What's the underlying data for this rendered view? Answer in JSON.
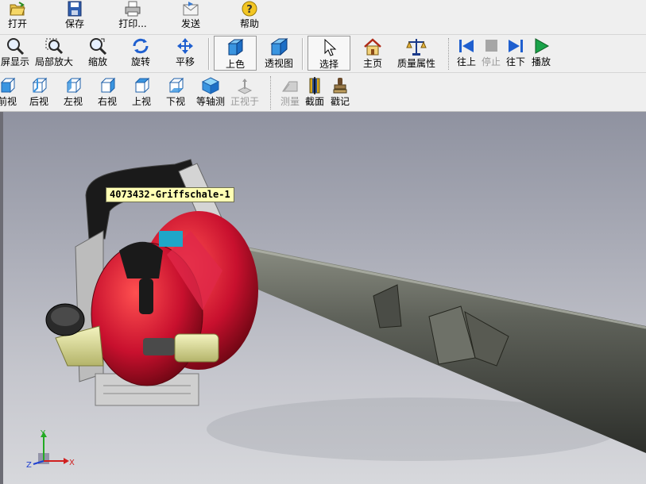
{
  "toolbar_main": {
    "open": "打开",
    "save": "保存",
    "print": "打印...",
    "send": "发送",
    "help": "帮助"
  },
  "toolbar_view": {
    "fit": "屏显示",
    "zoom_area": "局部放大",
    "zoom": "缩放",
    "rotate": "旋转",
    "pan": "平移",
    "shaded": "上色",
    "perspective": "透视图",
    "select": "选择",
    "home": "主页",
    "mass_properties": "质量属性",
    "previous": "往上",
    "stop": "停止",
    "next": "往下",
    "play": "播放"
  },
  "toolbar_orient": {
    "front": "前视",
    "back": "后视",
    "left": "左视",
    "right": "右视",
    "top": "上视",
    "bottom": "下视",
    "isometric": "等轴测",
    "normal_to": "正视于",
    "measure": "测量",
    "section": "截面",
    "stamp": "戳记"
  },
  "viewport": {
    "tooltip": "4073432-Griffschale-1",
    "triad": {
      "x": "X",
      "y": "Y",
      "z": "Z"
    }
  },
  "colors": {
    "toolbar_bg": "#efefef",
    "viewport_top": "#8f92a0",
    "viewport_bottom": "#d7d8dc",
    "engine_red": "#c8102e",
    "tube_gray": "#5f625a",
    "tank_yellow": "#d8d890",
    "tooltip_bg": "#ffffb4"
  }
}
